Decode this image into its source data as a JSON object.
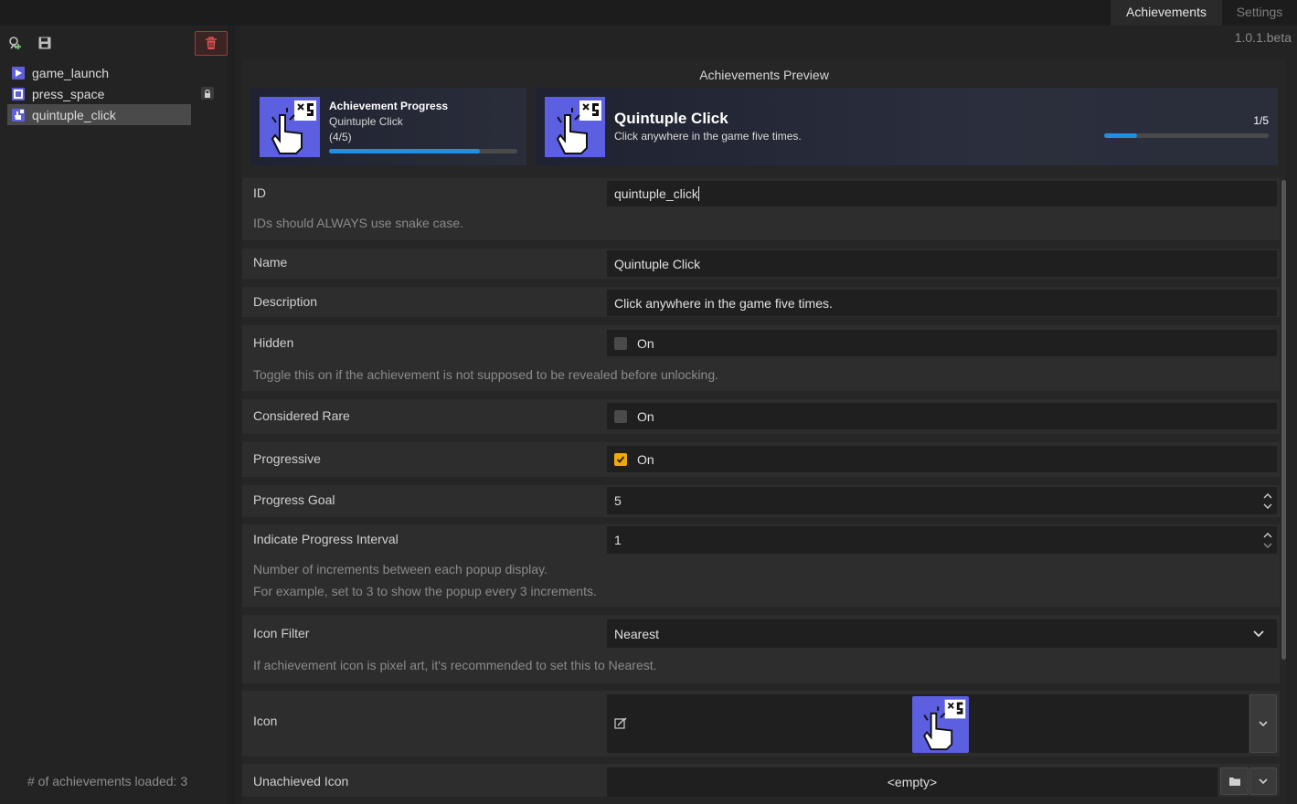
{
  "tabs": [
    {
      "label": "Achievements",
      "active": true
    },
    {
      "label": "Settings",
      "active": false
    }
  ],
  "version": "1.0.1.beta",
  "toolbar": {
    "add_icon": "add-achievement-icon",
    "save_icon": "save-icon",
    "delete_icon": "trash-icon"
  },
  "sidebar": {
    "items": [
      {
        "label": "game_launch",
        "icon": "play-icon",
        "selected": false,
        "locked": false
      },
      {
        "label": "press_space",
        "icon": "space-key-icon",
        "selected": false,
        "locked": true
      },
      {
        "label": "quintuple_click",
        "icon": "hand-click-icon",
        "selected": true,
        "locked": false
      }
    ],
    "loaded_text": "# of achievements loaded: 3"
  },
  "preview": {
    "title": "Achievements Preview",
    "small_card": {
      "heading": "Achievement Progress",
      "name": "Quintuple Click",
      "progress_text": "(4/5)",
      "progress": 0.8
    },
    "large_card": {
      "name": "Quintuple Click",
      "description": "Click anywhere in the game five times.",
      "count_text": "1/5",
      "progress": 0.2
    }
  },
  "form": {
    "id": {
      "label": "ID",
      "value": "quintuple_click",
      "help": "IDs should ALWAYS use snake case."
    },
    "name": {
      "label": "Name",
      "value": "Quintuple Click"
    },
    "description": {
      "label": "Description",
      "value": "Click anywhere in the game five times."
    },
    "hidden": {
      "label": "Hidden",
      "check_label": "On",
      "checked": false,
      "help": "Toggle this on if the achievement is not supposed to be revealed before unlocking."
    },
    "rare": {
      "label": "Considered Rare",
      "check_label": "On",
      "checked": false
    },
    "progressive": {
      "label": "Progressive",
      "check_label": "On",
      "checked": true
    },
    "progress_goal": {
      "label": "Progress Goal",
      "value": "5"
    },
    "interval": {
      "label": "Indicate Progress Interval",
      "value": "1",
      "help1": "Number of increments between each popup display.",
      "help2": "For example, set to 3 to show the popup every 3 increments."
    },
    "icon_filter": {
      "label": "Icon Filter",
      "value": "Nearest",
      "help": "If achievement icon is pixel art, it's recommended to set this to Nearest."
    },
    "icon": {
      "label": "Icon"
    },
    "unachieved_icon": {
      "label": "Unachieved Icon",
      "value": "<empty>"
    }
  },
  "colors": {
    "accent": "#1f8fe6",
    "checkbox_on": "#f0a90a",
    "icon_bg": "#5b5fe0",
    "danger": "#a23a3a"
  }
}
